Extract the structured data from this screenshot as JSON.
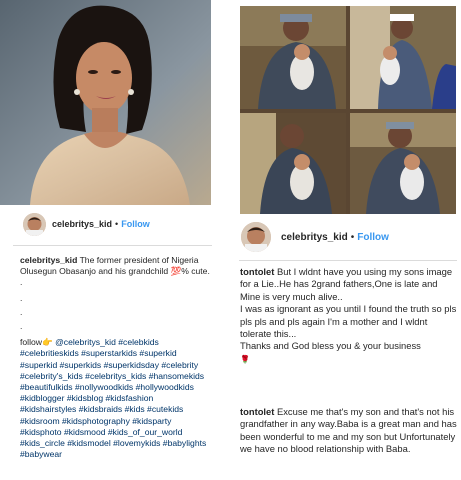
{
  "left": {
    "post": {
      "username": "celebritys_kid",
      "separator": "•",
      "follow_label": "Follow"
    },
    "caption": {
      "username": "celebritys_kid",
      "text": "The former president of Nigeria Olusegun Obasanjo and his grandchild 💯% cute. .",
      "dots": [
        ".",
        ".",
        "."
      ],
      "follow_line_prefix": "follow👉",
      "mention": "@celebritys_kid",
      "hashtags": "#celebkids #celebritieskids #superstarkids #superkid #superkid #superkids #superkidsday #celebrity #celebrity's_kids #celebritys_kids #hansomekids #beautifulkids #nollywoodkids #hollywoodkids #kidblogger #kidsblog #kidsfashion #kidshairstyles #kidsbraids #kids #cutekids #kidsroom #kidsphotography #kidsparty #kidsphoto #kidsmood #kids_of_our_world #kids_circle #kidsmodel #lovemykids #babylights #babywear"
    }
  },
  "right": {
    "post": {
      "username": "celebritys_kid",
      "separator": "•",
      "follow_label": "Follow"
    },
    "comments": [
      {
        "username": "tontolet",
        "paragraphs": [
          "But I wldnt have you using my sons image for a Lie..He has 2grand fathers,One is late and Mine is very much alive..",
          "I was as ignorant as you until I found the truth so pls pls pls and pls again I'm a mother and I wldnt tolerate this...",
          "Thanks and God bless you & your business"
        ],
        "emoji": "🌹"
      },
      {
        "username": "tontolet",
        "paragraphs": [
          "Excuse me that's my son and that's not his grandfather in any way.Baba is a great man and has been wonderful to me and my son but Unfortunately we have no blood relationship with Baba."
        ]
      }
    ]
  },
  "colors": {
    "link_blue": "#3897f0",
    "hashtag_blue": "#003569",
    "text": "#262626",
    "divider": "#dbdbdb"
  },
  "icons": {
    "avatar": "baby-portrait-avatar",
    "photos": [
      "woman-portrait-photo",
      "man-holding-baby-photo-collage"
    ]
  }
}
